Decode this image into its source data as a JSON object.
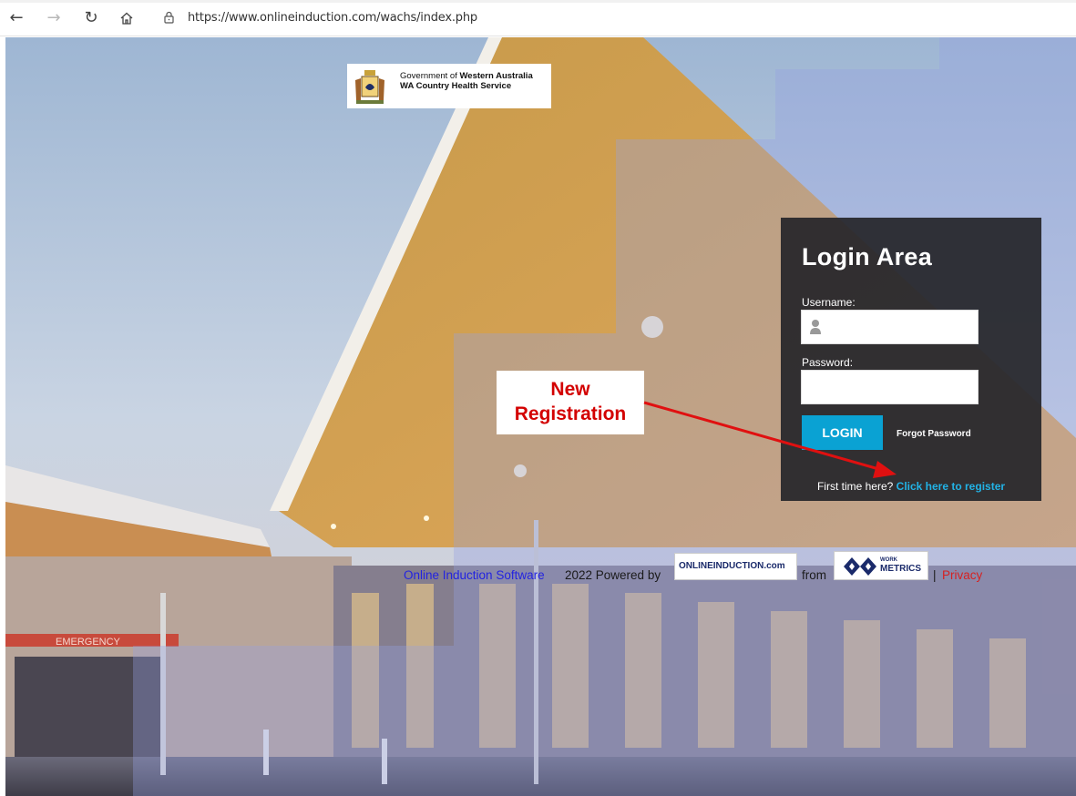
{
  "browser": {
    "url": "https://www.onlineinduction.com/wachs/index.php",
    "icons": [
      "back-icon",
      "forward-icon",
      "reload-icon",
      "home-icon",
      "lock-icon"
    ]
  },
  "logo": {
    "line1_prefix": "Government of ",
    "line1_bold": "Western Australia",
    "line2": "WA Country Health Service"
  },
  "login": {
    "title": "Login Area",
    "username_label": "Username:",
    "password_label": "Password:",
    "login_button": "LOGIN",
    "forgot_password": "Forgot Password",
    "first_time_text": "First time here? ",
    "register_link": "Click here to register"
  },
  "annotation": {
    "line1": "New",
    "line2": "Registration"
  },
  "footer": {
    "software_link": "Online Induction Software",
    "year_powered": "2022 Powered by",
    "onlineinduction_logo": "ONLINEINDUCTION.com",
    "from": "from",
    "workmetrics_small": "WORK",
    "workmetrics_big": "METRICS",
    "separator": "|",
    "privacy": "Privacy"
  },
  "colors": {
    "login_button": "#0aa2d3",
    "register_link": "#22b3e6",
    "annotation_red": "#d30000",
    "footer_link_blue": "#2323e0",
    "privacy_red": "#d62121"
  }
}
